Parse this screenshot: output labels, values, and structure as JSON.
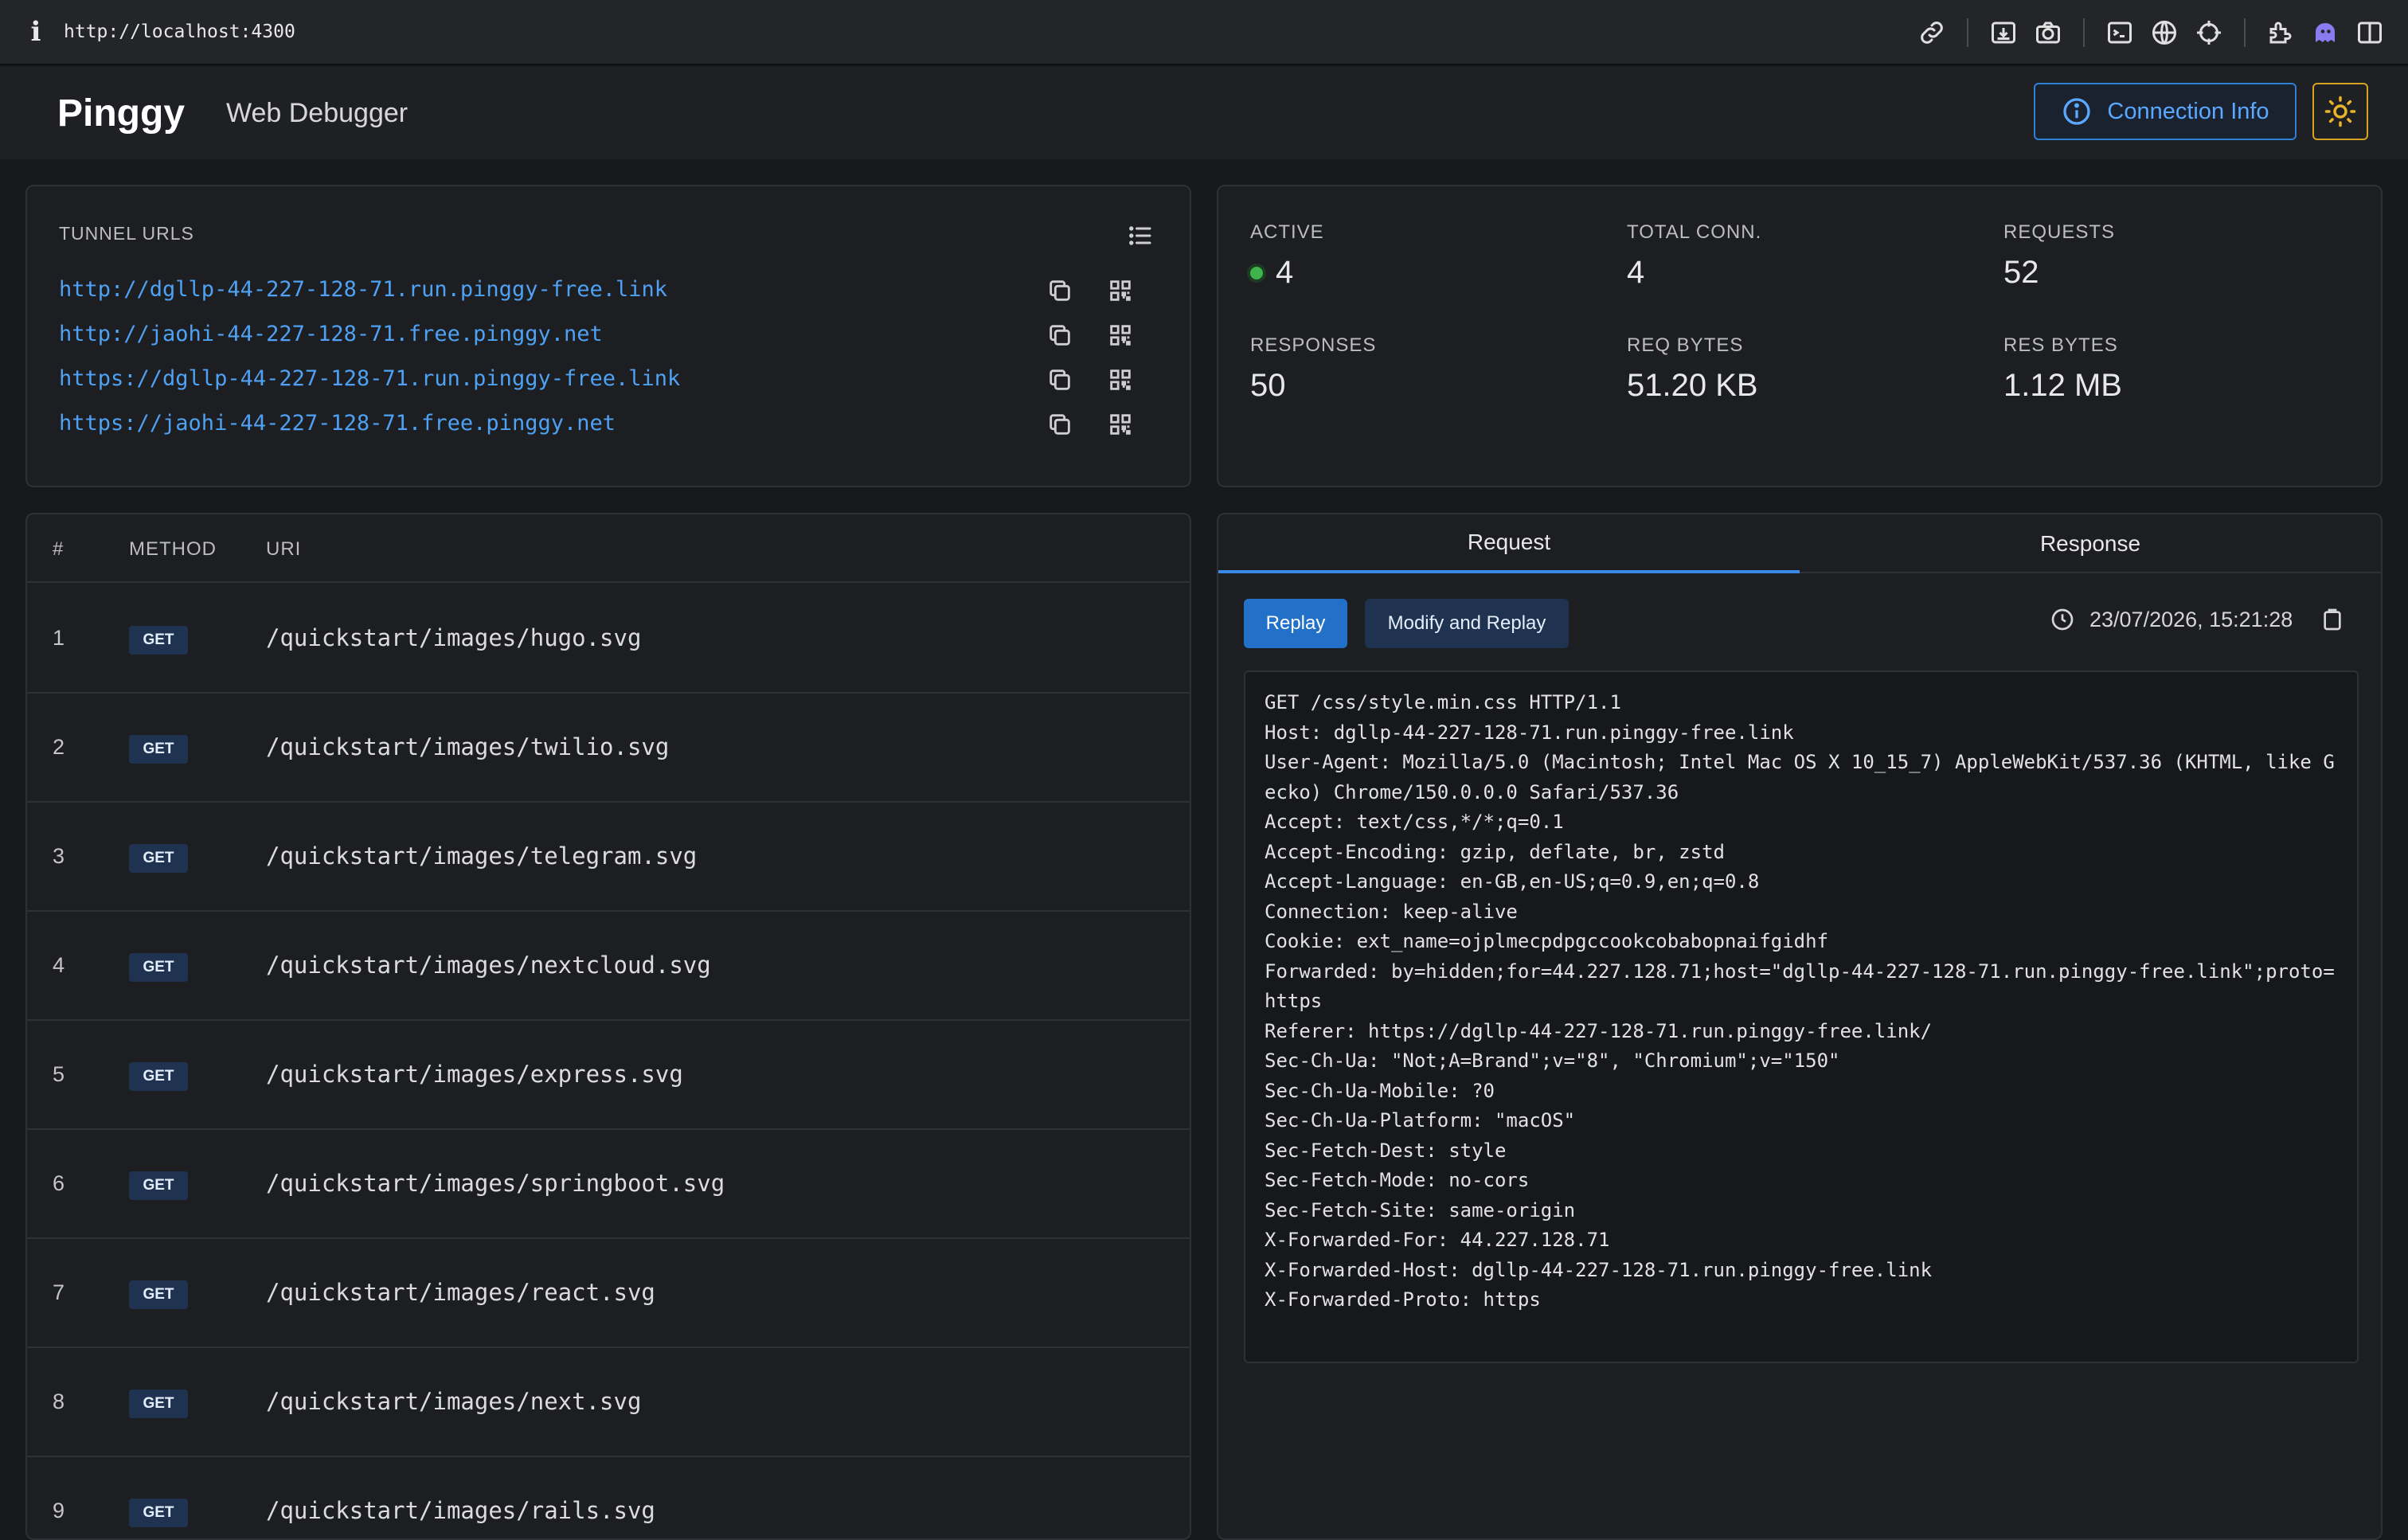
{
  "browser": {
    "info_glyph": "i",
    "url": "http://localhost:4300",
    "toolbar_icons": [
      "link-icon",
      "download-icon",
      "camera-icon",
      "terminal-icon",
      "globe-icon",
      "crosshair-icon",
      "extension-icon",
      "ghost-icon",
      "sidebar-icon"
    ]
  },
  "header": {
    "brand": "Pinggy",
    "subtitle": "Web Debugger",
    "connection_info_label": "Connection Info"
  },
  "tunnels": {
    "title": "TUNNEL URLS",
    "urls": [
      "http://dgllp-44-227-128-71.run.pinggy-free.link",
      "http://jaohi-44-227-128-71.free.pinggy.net",
      "https://dgllp-44-227-128-71.run.pinggy-free.link",
      "https://jaohi-44-227-128-71.free.pinggy.net"
    ]
  },
  "stats": {
    "active": {
      "label": "ACTIVE",
      "value": "4"
    },
    "total_conn": {
      "label": "TOTAL CONN.",
      "value": "4"
    },
    "requests": {
      "label": "REQUESTS",
      "value": "52"
    },
    "responses": {
      "label": "RESPONSES",
      "value": "50"
    },
    "req_bytes": {
      "label": "REQ BYTES",
      "value": "51.20 KB"
    },
    "res_bytes": {
      "label": "RES BYTES",
      "value": "1.12 MB"
    }
  },
  "table": {
    "col_num": "#",
    "col_method": "METHOD",
    "col_uri": "URI",
    "rows": [
      {
        "num": "1",
        "method": "GET",
        "uri": "/quickstart/images/hugo.svg"
      },
      {
        "num": "2",
        "method": "GET",
        "uri": "/quickstart/images/twilio.svg"
      },
      {
        "num": "3",
        "method": "GET",
        "uri": "/quickstart/images/telegram.svg"
      },
      {
        "num": "4",
        "method": "GET",
        "uri": "/quickstart/images/nextcloud.svg"
      },
      {
        "num": "5",
        "method": "GET",
        "uri": "/quickstart/images/express.svg"
      },
      {
        "num": "6",
        "method": "GET",
        "uri": "/quickstart/images/springboot.svg"
      },
      {
        "num": "7",
        "method": "GET",
        "uri": "/quickstart/images/react.svg"
      },
      {
        "num": "8",
        "method": "GET",
        "uri": "/quickstart/images/next.svg"
      },
      {
        "num": "9",
        "method": "GET",
        "uri": "/quickstart/images/rails.svg"
      }
    ]
  },
  "detail": {
    "tab_request": "Request",
    "tab_response": "Response",
    "replay_label": "Replay",
    "modify_replay_label": "Modify and Replay",
    "timestamp": "23/07/2026, 15:21:28",
    "raw_lines": [
      "GET /css/style.min.css HTTP/1.1",
      "Host: dgllp-44-227-128-71.run.pinggy-free.link",
      "User-Agent: Mozilla/5.0 (Macintosh; Intel Mac OS X 10_15_7) AppleWebKit/537.36 (KHTML, like G",
      "ecko) Chrome/150.0.0.0 Safari/537.36",
      "Accept: text/css,*/*;q=0.1",
      "Accept-Encoding: gzip, deflate, br, zstd",
      "Accept-Language: en-GB,en-US;q=0.9,en;q=0.8",
      "Connection: keep-alive",
      "Cookie: ext_name=ojplmecpdpgccookcobabopnaifgidhf",
      "Forwarded: by=hidden;for=44.227.128.71;host=\"dgllp-44-227-128-71.run.pinggy-free.link\";proto=",
      "https",
      "Referer: https://dgllp-44-227-128-71.run.pinggy-free.link/",
      "Sec-Ch-Ua: \"Not;A=Brand\";v=\"8\", \"Chromium\";v=\"150\"",
      "Sec-Ch-Ua-Mobile: ?0",
      "Sec-Ch-Ua-Platform: \"macOS\"",
      "Sec-Fetch-Dest: style",
      "Sec-Fetch-Mode: no-cors",
      "Sec-Fetch-Site: same-origin",
      "X-Forwarded-For: 44.227.128.71",
      "X-Forwarded-Host: dgllp-44-227-128-71.run.pinggy-free.link",
      "X-Forwarded-Proto: https"
    ]
  },
  "colors": {
    "accent": "#2270c8",
    "link": "#4ea1f3",
    "active_dot": "#3fb44d",
    "theme_toggle": "#d4a21f"
  }
}
